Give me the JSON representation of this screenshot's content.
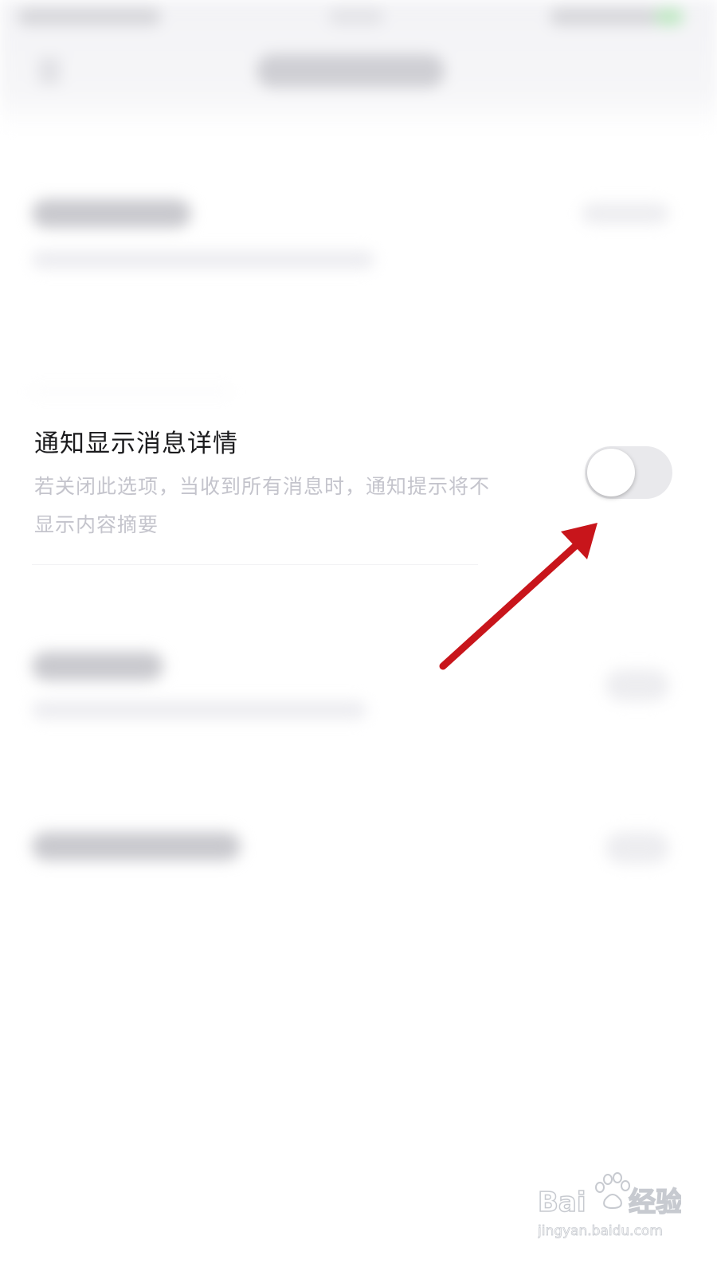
{
  "setting": {
    "title": "通知显示消息详情",
    "description_line1": "若关闭此选项，当收到所有消息时，通知提示将不",
    "description_line2": "显示内容摘要",
    "toggle_on": false
  },
  "colors": {
    "title_text": "#1b1b1d",
    "description_text": "#c4c4cc",
    "toggle_off_track": "#e9e9ec",
    "annotation_arrow": "#c8151b"
  },
  "icons": {
    "annotation": "red-arrow-icon",
    "watermark": "baidu-jingyan-watermark"
  },
  "watermark": {
    "brand": "Baidu",
    "product": "经验",
    "domain": "jingyan.baidu.com"
  }
}
